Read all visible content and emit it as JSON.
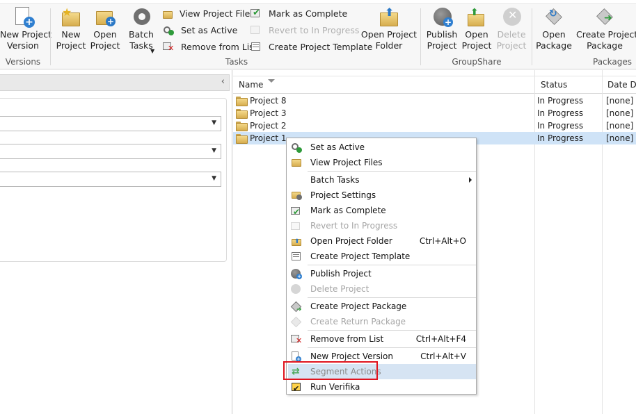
{
  "ribbon": {
    "groups": {
      "versions": "Versions",
      "tasks": "Tasks",
      "groupshare": "GroupShare",
      "packages": "Packages"
    },
    "new_project_version": "New Project\nVersion",
    "new_project": "New\nProject",
    "open_project": "Open\nProject",
    "batch_tasks": "Batch\nTasks",
    "view_project_files": "View Project Files",
    "set_as_active": "Set as Active",
    "remove_from_list": "Remove from List",
    "mark_as_complete": "Mark as Complete",
    "revert_to_in_progress": "Revert to In Progress",
    "create_project_template": "Create Project Template",
    "open_project_folder": "Open Project\nFolder",
    "publish_project": "Publish\nProject",
    "open_project_gs": "Open\nProject",
    "delete_project": "Delete\nProject",
    "open_package": "Open\nPackage",
    "create_project_package": "Create Project\nPackage"
  },
  "grid": {
    "columns": [
      "Name",
      "Status",
      "Date Du"
    ],
    "rows": [
      {
        "name": "Project 8",
        "status": "In Progress",
        "date": "[none]"
      },
      {
        "name": "Project 3",
        "status": "In Progress",
        "date": "[none]"
      },
      {
        "name": "Project 2",
        "status": "In Progress",
        "date": "[none]"
      },
      {
        "name": "Project 1",
        "status": "In Progress",
        "date": "[none]"
      }
    ]
  },
  "context_menu": {
    "set_as_active": "Set as Active",
    "view_project_files": "View Project Files",
    "batch_tasks": "Batch Tasks",
    "project_settings": "Project Settings",
    "mark_as_complete": "Mark as Complete",
    "revert_to_in_progress": "Revert to In Progress",
    "open_project_folder": "Open Project Folder",
    "open_project_folder_shortcut": "Ctrl+Alt+O",
    "create_project_template": "Create Project Template",
    "publish_project": "Publish Project",
    "delete_project": "Delete Project",
    "create_project_package": "Create Project Package",
    "create_return_package": "Create Return Package",
    "remove_from_list": "Remove from List",
    "remove_from_list_shortcut": "Ctrl+Alt+F4",
    "new_project_version": "New Project Version",
    "new_project_version_shortcut": "Ctrl+Alt+V",
    "segment_actions": "Segment Actions",
    "run_verifika": "Run Verifika"
  },
  "colors": {
    "selection": "#cfe3f7",
    "menu_hover": "#d6e4f3",
    "highlight_box": "#e0141e",
    "disabled_text": "#a5a5a5"
  }
}
